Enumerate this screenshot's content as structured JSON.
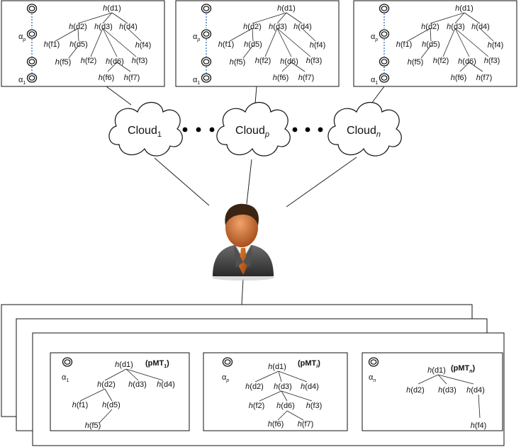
{
  "clouds": [
    {
      "base": "Cloud",
      "sub": "1",
      "sub_italic": false
    },
    {
      "base": "Cloud",
      "sub": "p",
      "sub_italic": true
    },
    {
      "base": "Cloud",
      "sub": "n",
      "sub_italic": true
    }
  ],
  "hash_prefix": "h",
  "top_tree_labels": {
    "d1": "(d1)",
    "d2": "(d2)",
    "d3": "(d3)",
    "d4": "(d4)",
    "d5": "(d5)",
    "d6": "(d6)",
    "f1": "(f1)",
    "f2": "(f2)",
    "f3": "(f3)",
    "f4": "(f4)",
    "f5": "(f5)",
    "f6": "(f6)",
    "f7": "(f7)"
  },
  "alpha": "α",
  "alpha_p_sub": "p",
  "alpha_1_sub": "1",
  "chain_alpha_p": "α",
  "chain_alpha_1": "α",
  "bottom_trees": [
    {
      "alpha_sub": "1",
      "name": "pMT",
      "name_sub": "1"
    },
    {
      "alpha_sub": "p",
      "name": "pMT",
      "name_sub": "i"
    },
    {
      "alpha_sub": "n",
      "name": "pMT",
      "name_sub": "n"
    }
  ],
  "bottom_labels": {
    "d1": "(d1)",
    "d2": "(d2)",
    "d3": "(d3)",
    "d4": "(d4)",
    "d5": "(d5)",
    "d6": "(d6)",
    "f1": "(f1)",
    "f2": "(f2)",
    "f3": "(f3)",
    "f4": "(f4)",
    "f5": "(f5)",
    "f6": "(f6)",
    "f7": "(f7)"
  }
}
